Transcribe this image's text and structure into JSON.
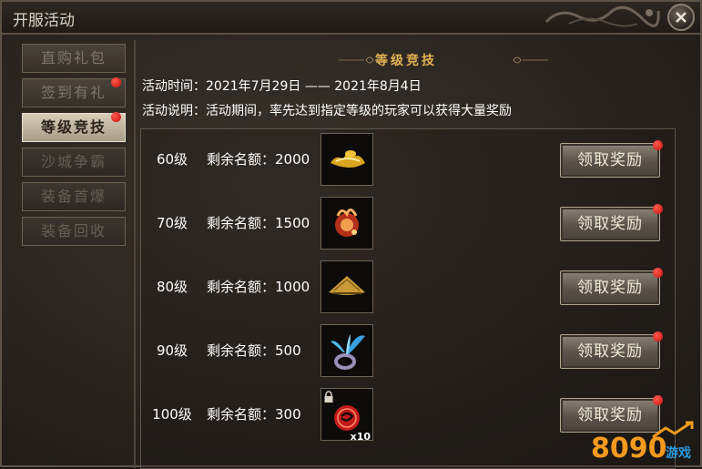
{
  "window": {
    "title": "开服活动"
  },
  "sidebar": {
    "items": [
      {
        "label": "直购礼包",
        "state": "normal",
        "dot": false
      },
      {
        "label": "签到有礼",
        "state": "normal",
        "dot": true
      },
      {
        "label": "等级竞技",
        "state": "active",
        "dot": true
      },
      {
        "label": "沙城争霸",
        "state": "dim",
        "dot": false
      },
      {
        "label": "装备首爆",
        "state": "dim",
        "dot": false
      },
      {
        "label": "装备回收",
        "state": "dim",
        "dot": false
      }
    ]
  },
  "section": {
    "title": "等级竞技",
    "time_label": "活动时间：",
    "time_value": "2021年7月29日 —— 2021年8月4日",
    "desc_label": "活动说明：",
    "desc_value": "活动期间，率先达到指定等级的玩家可以获得大量奖励"
  },
  "rewards": [
    {
      "level": "60级",
      "quota": "剩余名额：2000",
      "item_icon": "gold-ingot-icon",
      "button": "领取奖励"
    },
    {
      "level": "70级",
      "quota": "剩余名额：1500",
      "item_icon": "fire-orb-icon",
      "button": "领取奖励"
    },
    {
      "level": "80级",
      "quota": "剩余名额：1000",
      "item_icon": "bamboo-hat-icon",
      "button": "领取奖励"
    },
    {
      "level": "90级",
      "quota": "剩余名额：500",
      "item_icon": "blue-ring-icon",
      "button": "领取奖励"
    },
    {
      "level": "100级",
      "quota": "剩余名额：300",
      "item_icon": "red-token-icon",
      "item_count": "x10",
      "locked": true,
      "button": "领取奖励"
    }
  ],
  "watermark": {
    "text": "8090游戏"
  },
  "colors": {
    "accent_gold": "#e4b354",
    "notify_red": "#d91b1b",
    "active_tab": "#cfc5b1"
  }
}
